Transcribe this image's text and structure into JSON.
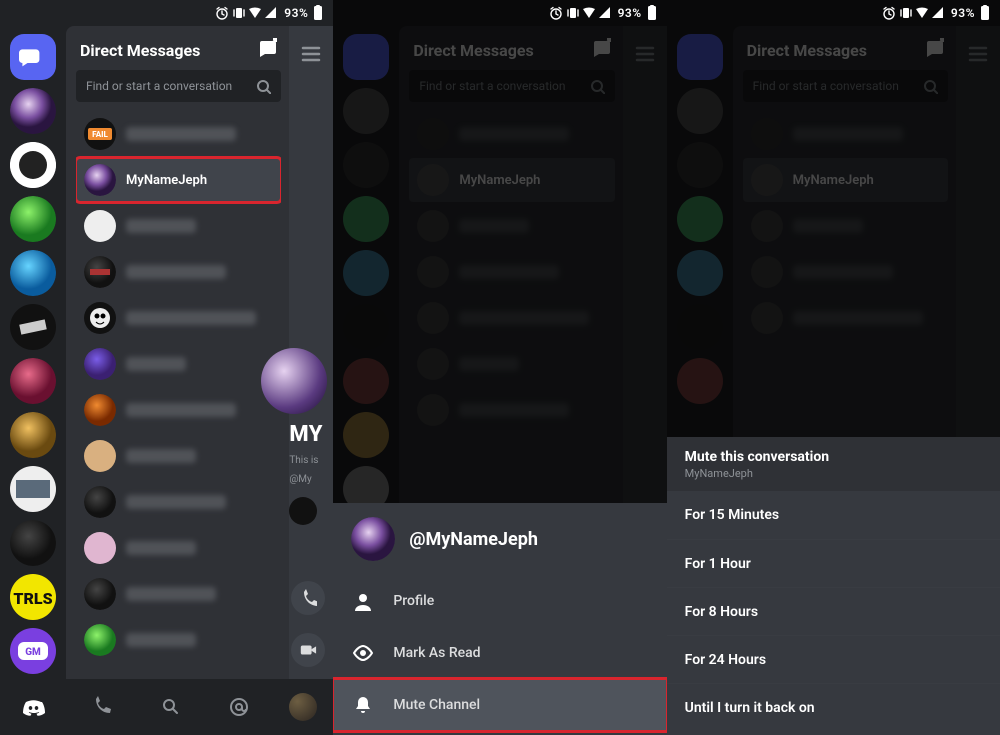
{
  "status": {
    "battery_pct": "93%"
  },
  "dm": {
    "header": "Direct Messages",
    "search_placeholder": "Find or start a conversation",
    "selected_name": "MyNameJeph"
  },
  "profile_peek": {
    "name_fragment": "MY",
    "line1": "This is",
    "line2": "@My"
  },
  "sheet": {
    "username": "@MyNameJeph",
    "items": {
      "profile": "Profile",
      "mark_read": "Mark As Read",
      "mute": "Mute Channel"
    }
  },
  "mute": {
    "title": "Mute this conversation",
    "subtitle": "MyNameJeph",
    "options": {
      "m15": "For 15 Minutes",
      "h1": "For 1 Hour",
      "h8": "For 8 Hours",
      "h24": "For 24 Hours",
      "forever": "Until I turn it back on"
    }
  }
}
